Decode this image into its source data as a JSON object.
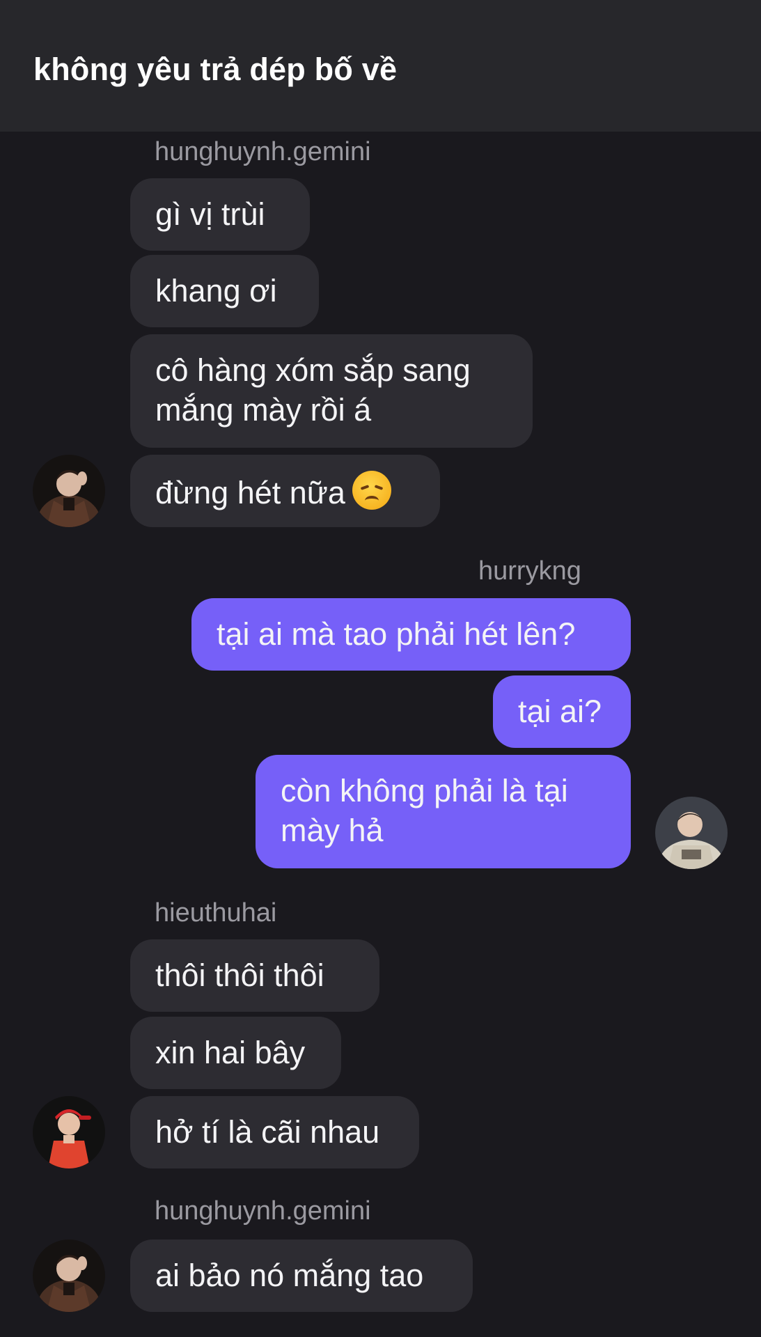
{
  "header": {
    "title": "không yêu trả dép bố về"
  },
  "groups": [
    {
      "sender": "hunghuynh.gemini",
      "messages": [
        "gì vị trùi",
        "khang ơi",
        "cô hàng xóm sắp sang",
        "mắng mày rồi á",
        "đừng hét nữa"
      ],
      "emoji": "disappointed-face-icon"
    },
    {
      "sender": "hurrykng",
      "messages": [
        "tại ai mà tao phải hét lên?",
        "tại ai?",
        "còn không phải là tại",
        "mày hả"
      ]
    },
    {
      "sender": "hieuthuhai",
      "messages": [
        "thôi thôi thôi",
        "xin hai bây",
        "hở tí là cãi nhau"
      ]
    },
    {
      "sender": "hunghuynh.gemini",
      "messages": [
        "ai bảo nó mắng tao"
      ]
    }
  ],
  "colors": {
    "background": "#1a191e",
    "header": "#27272b",
    "incoming_bubble": "#2d2c32",
    "outgoing_bubble": "#7660f8",
    "sender_text": "#9b9aa1"
  }
}
